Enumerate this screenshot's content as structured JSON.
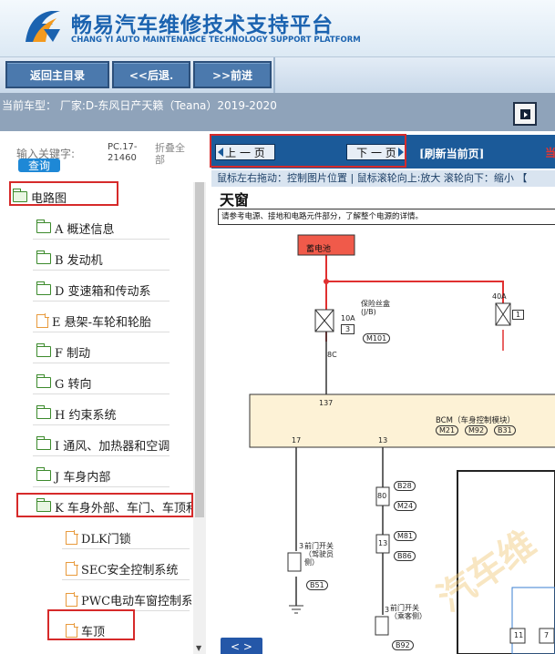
{
  "app": {
    "title_cn": "畅易汽车维修技术支持平台",
    "title_en": "CHANG YI AUTO MAINTENANCE TECHNOLOGY SUPPORT PLATFORM"
  },
  "nav": {
    "home": "返回主目录",
    "back": "<<后退.",
    "forward": ">>前进"
  },
  "model_bar": {
    "label": "当前车型： 厂家:D-东风日产天籁（Teana）2019-2020"
  },
  "search": {
    "label": "输入关键字:",
    "button": "查询",
    "code": "PC.17-21460",
    "collapse_all": "折叠全部"
  },
  "tree": {
    "root": "电路图",
    "items": [
      "A 概述信息",
      "B 发动机",
      "D 变速箱和传动系",
      "E 悬架-车轮和轮胎",
      "F 制动",
      "G 转向",
      "H 约束系统",
      "I 通风、加热器和空调",
      "J 车身内部",
      "K 车身外部、车门、车顶和"
    ],
    "children": [
      "DLK门锁",
      "SEC安全控制系统",
      "PWC电动车窗控制系",
      "车顶"
    ]
  },
  "pager": {
    "prev": "上 一 页",
    "next": "下 一 页",
    "refresh": "[刷新当前页]",
    "current_red": "当"
  },
  "hint": "鼠标左右拖动：控制图片位置 | 鼠标滚轮向上:放大  滚轮向下：缩小  【",
  "diagram": {
    "title": "天窗",
    "note": "请参考电源、接地和电路元件部分，了解整个电源的详情。",
    "battery": "蓄电池",
    "fuse_40a": "40A",
    "fuse_40a_num": "1",
    "fuse_block": "保险丝盒\n(J/B)",
    "fuse_10a": "10A",
    "fuse_10a_num": "3",
    "m101": "M101",
    "pin_8c": "8C",
    "pin_137": "137",
    "bcm": "BCM（车身控制模块）",
    "m21": "M21",
    "m92": "M92",
    "b31": "B31",
    "pin_17": "17",
    "pin_13": "13",
    "pin_80": "80",
    "pin_13b": "13",
    "b28": "B28",
    "m24": "M24",
    "m81": "M81",
    "b86": "B86",
    "pin_3a": "3",
    "switch_driver": "前门开关（驾驶员侧）",
    "b51": "B51",
    "pin_3b": "3",
    "switch_passenger": "前门开关（乘客侧）",
    "b92": "B92",
    "pin_11": "11",
    "pin_7": "7",
    "nav_arrows": "< >",
    "watermark": "汽车维"
  },
  "colors": {
    "brand_blue": "#1b63b0",
    "nav_button": "#4b79ad",
    "pager_bg": "#1b5a99",
    "highlight_red": "#d62a2a"
  }
}
